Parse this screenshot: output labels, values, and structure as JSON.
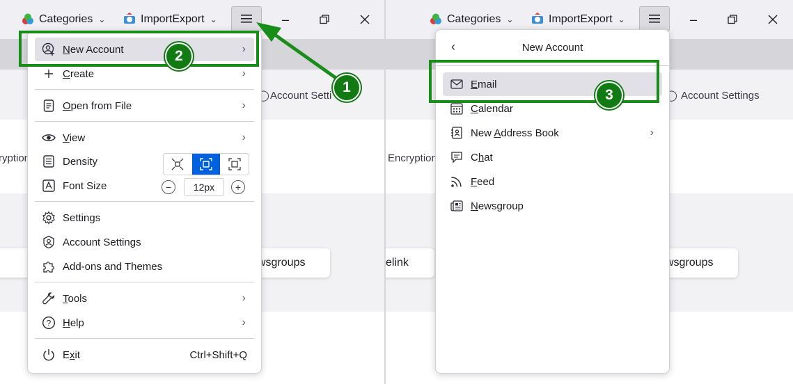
{
  "left": {
    "toolbar": {
      "categories": "Categories",
      "import_export": "ImportExport"
    },
    "background": {
      "account_settings_partial": "Account Setti",
      "encryption_partial": "ryption",
      "newsgroups_partial": "wsgroups"
    },
    "menu": {
      "items": [
        {
          "label": "New Account",
          "underline": "N",
          "rest": "ew Account"
        },
        {
          "label": "Create",
          "underline": "C",
          "rest": "reate"
        },
        {
          "label": "Open from File",
          "underline": "O",
          "rest": "pen from File"
        },
        {
          "label": "View",
          "underline": "V",
          "rest": "iew"
        },
        {
          "label": "Density"
        },
        {
          "label": "Font Size"
        },
        {
          "label": "Settings"
        },
        {
          "label": "Account Settings"
        },
        {
          "label": "Add-ons and Themes"
        },
        {
          "label": "Tools",
          "underline": "T",
          "rest": "ools"
        },
        {
          "label": "Help",
          "underline": "H",
          "rest": "elp"
        },
        {
          "label": "Exit",
          "underline": "x",
          "pre": "E",
          "rest": "it",
          "shortcut": "Ctrl+Shift+Q"
        }
      ],
      "font_size_value": "12px"
    }
  },
  "right": {
    "toolbar": {
      "categories": "Categories",
      "import_export": "ImportExport"
    },
    "background": {
      "account_settings": "Account Settings",
      "encryption": "Encryption",
      "elink_partial": "elink",
      "newsgroups_partial": "wsgroups"
    },
    "submenu": {
      "title": "New Account",
      "items": [
        {
          "label": "Email",
          "underline": "E",
          "rest": "mail"
        },
        {
          "label": "Calendar",
          "underline": "C",
          "rest": "alendar"
        },
        {
          "label": "New Address Book",
          "pre": "New ",
          "underline": "A",
          "rest": "ddress Book"
        },
        {
          "label": "Chat",
          "pre": "C",
          "underline": "h",
          "rest": "at"
        },
        {
          "label": "Feed",
          "underline": "F",
          "rest": "eed"
        },
        {
          "label": "Newsgroup",
          "underline": "N",
          "rest": "ewsgroup"
        }
      ]
    }
  },
  "annotations": {
    "step1": "1",
    "step2": "2",
    "step3": "3",
    "highlight_color": "#1a8c1a",
    "badge_color": "#127a12"
  }
}
